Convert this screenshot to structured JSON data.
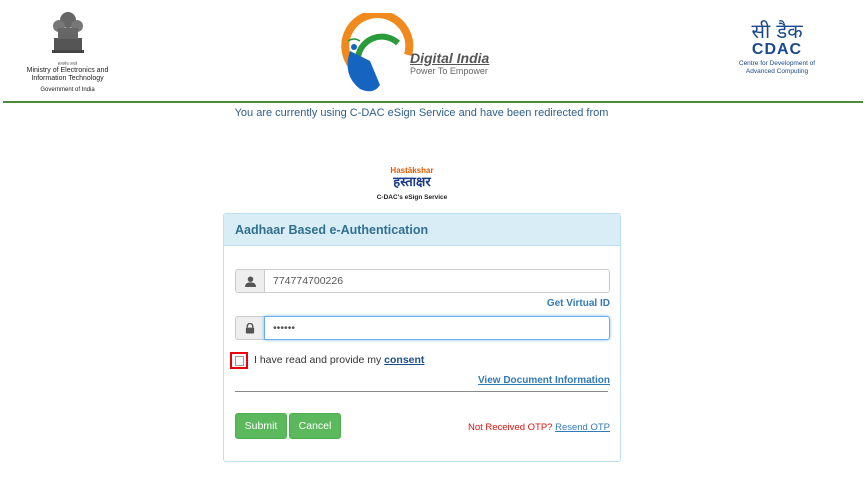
{
  "header": {
    "ministry": {
      "motto": "सत्यमेव जयते",
      "line1": "Ministry of Electronics and",
      "line2": "Information Technology",
      "line3": "Government of India"
    },
    "digital_india": {
      "title": "Digital India",
      "tagline": "Power To Empower"
    },
    "cdac": {
      "hindi": "सी डैक",
      "english": "CDAC",
      "sub1": "Centre for Development of",
      "sub2": "Advanced Computing"
    }
  },
  "redirect_notice": "You are currently using C-DAC eSign Service and have been redirected from",
  "hastakshar": {
    "top": "Hastākshar",
    "main": "हस्ताक्षर",
    "sub": "C-DAC's eSign Service"
  },
  "panel": {
    "title": "Aadhaar Based e-Authentication",
    "aadhaar_value": "774774700226",
    "get_virtual_id": "Get Virtual ID",
    "otp_value": "••••••",
    "consent_prefix": "I have read and provide my",
    "consent_link": "consent",
    "view_document": "View Document Information",
    "submit_label": "Submit",
    "cancel_label": "Cancel",
    "otp_prompt": "Not Received OTP?",
    "resend_label": "Resend OTP"
  },
  "colors": {
    "accent_green": "#5cb85c",
    "panel_header": "#d9edf7",
    "link_blue": "#337ab7",
    "alert_red": "#d9140e"
  }
}
